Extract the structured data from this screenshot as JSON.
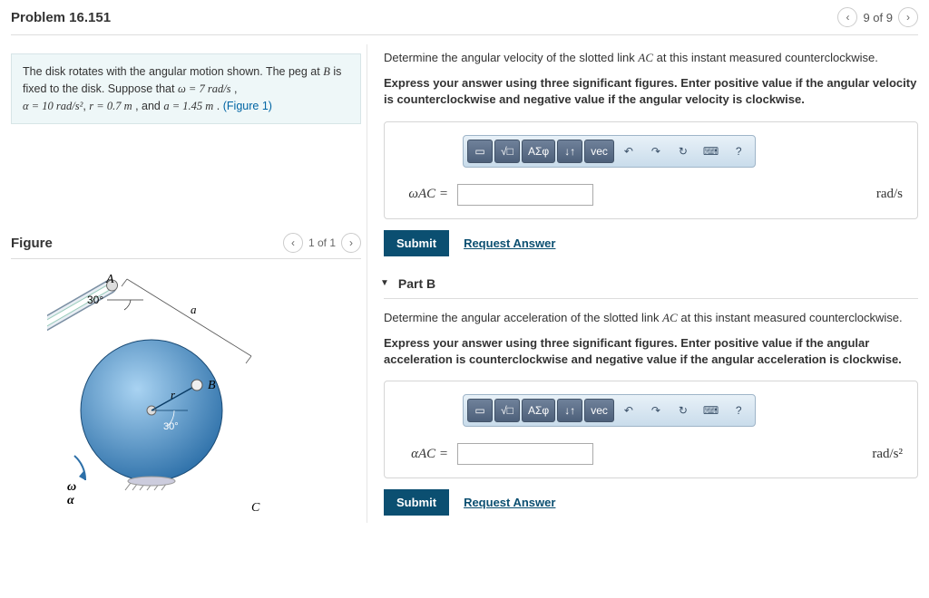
{
  "header": {
    "title": "Problem 16.151",
    "page_text": "9 of 9"
  },
  "left": {
    "prompt_line1": "The disk rotates with the angular motion shown. The peg at ",
    "prompt_B": "B",
    "prompt_line2": " is fixed to the disk. Suppose that ",
    "omega": "ω = 7  rad/s",
    "sep1": " , ",
    "alpha": "α = 10 rad/s²",
    "sep2": ", ",
    "r": "r = 0.7  m",
    "sep3": " , and ",
    "a": "a = 1.45  m",
    "sep4": " . ",
    "fig_ref": "(Figure 1)"
  },
  "figure": {
    "title": "Figure",
    "page": "1 of 1",
    "labels": {
      "A": "A",
      "B": "B",
      "C": "C",
      "a": "a",
      "r": "r",
      "omega": "ω",
      "alpha": "α",
      "ang1": "30°",
      "ang2": "30°"
    }
  },
  "partA": {
    "prompt1a": "Determine the angular velocity of the slotted link ",
    "prompt1b": "AC",
    "prompt1c": " at this instant measured counterclockwise.",
    "prompt2": "Express your answer using three significant figures. Enter positive value if the angular velocity is counterclockwise and negative value if the angular velocity is clockwise.",
    "var": "ωAC =",
    "unit": "rad/s",
    "submit": "Submit",
    "request": "Request Answer",
    "tb": {
      "frac": "□/□",
      "root": "√□",
      "greek": "ΑΣφ",
      "arrows": "↓↑",
      "vec": "vec",
      "undo": "↶",
      "redo": "↷",
      "reset": "↻",
      "kbd": "⌨",
      "help": "?"
    }
  },
  "partB": {
    "label": "Part B",
    "prompt1a": "Determine the angular acceleration of the slotted link ",
    "prompt1b": "AC",
    "prompt1c": " at this instant measured counterclockwise.",
    "prompt2": "Express your answer using three significant figures. Enter positive value if the angular acceleration is counterclockwise and negative value if the angular acceleration is clockwise.",
    "var": "αAC =",
    "unit": "rad/s²",
    "submit": "Submit",
    "request": "Request Answer"
  }
}
